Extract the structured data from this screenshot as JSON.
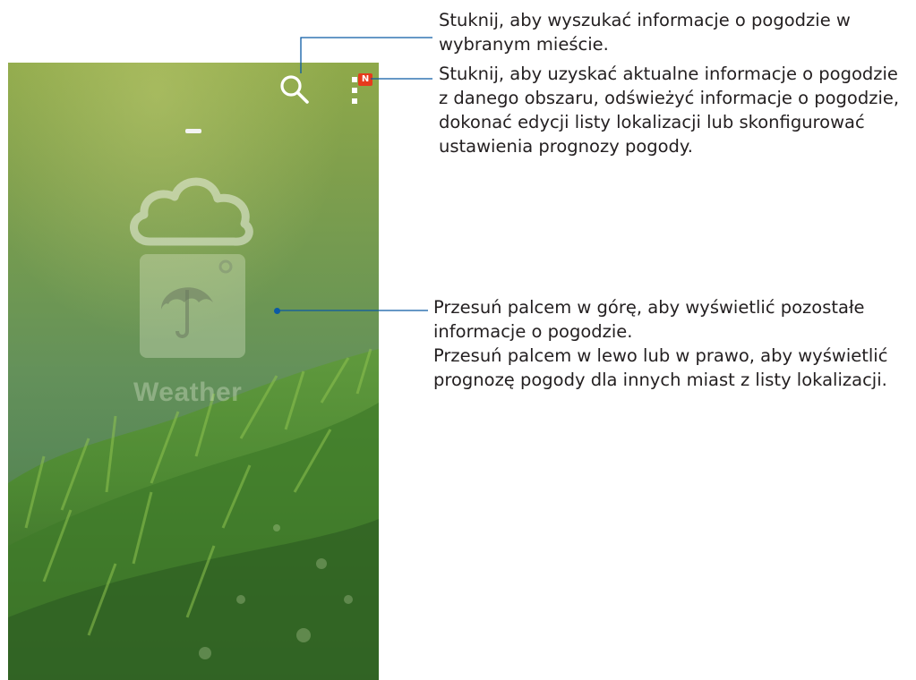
{
  "app": {
    "name": "Weather",
    "notification_badge": "N"
  },
  "icons": {
    "search": "search-icon",
    "menu": "overflow-menu-icon",
    "cloud": "cloud-icon",
    "umbrella": "umbrella-icon"
  },
  "colors": {
    "callout_line": "#0b5aa5",
    "badge": "#e63a1c",
    "text": "#231f20"
  },
  "callouts": {
    "search": "Stuknij, aby wyszukać informacje o pogodzie w\nwybranym mieście.",
    "menu": "Stuknij, aby uzyskać aktualne informacje o pogodzie\nz danego obszaru, odświeżyć informacje o pogodzie,\ndokonać edycji listy lokalizacji lub skonfigurować\nustawienia prognozy pogody.",
    "swipe": "Przesuń palcem w górę, aby wyświetlić pozostałe\ninformacje o pogodzie.\nPrzesuń palcem w lewo lub w prawo, aby wyświetlić\nprognozę pogody dla innych miast z listy lokalizacji."
  }
}
